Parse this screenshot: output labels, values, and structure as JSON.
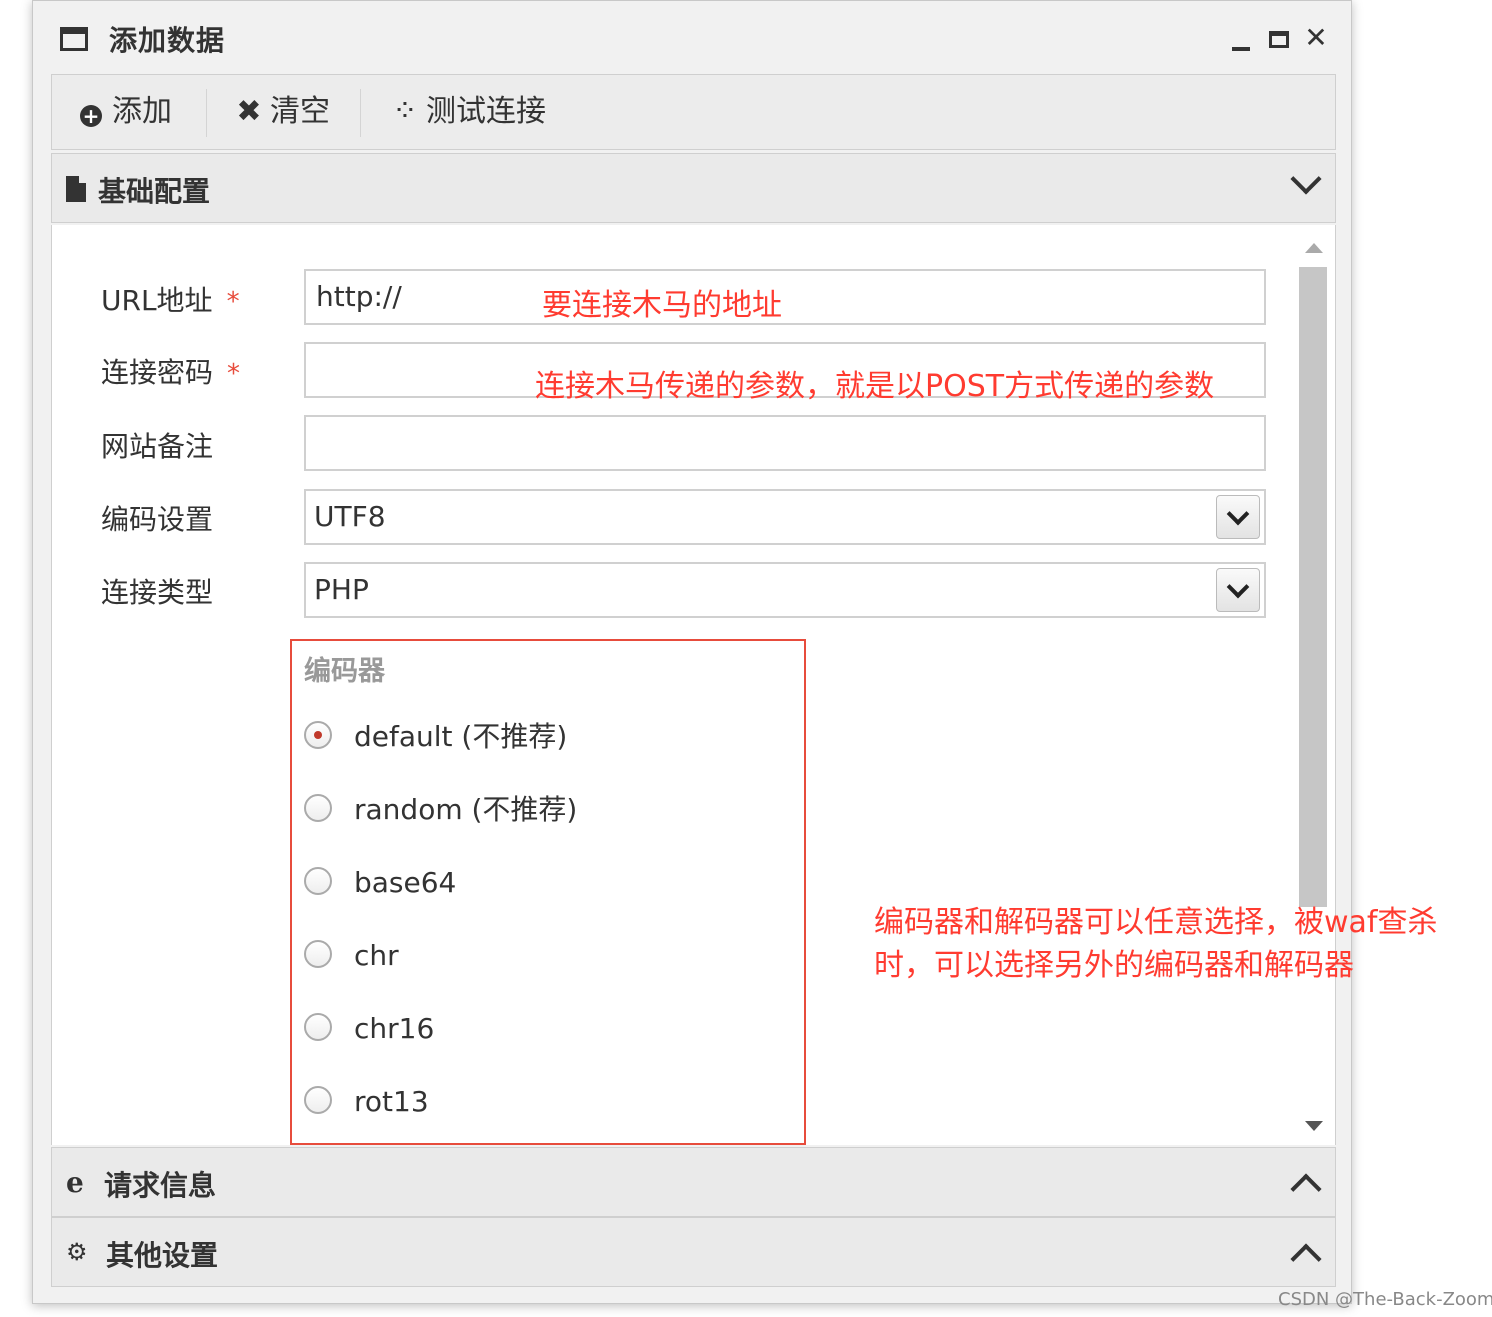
{
  "window": {
    "title": "添加数据"
  },
  "toolbar": {
    "add_label": "添加",
    "clear_label": "清空",
    "test_label": "测试连接"
  },
  "panels": {
    "basic": "基础配置",
    "request": "请求信息",
    "other": "其他设置"
  },
  "form": {
    "url_label": "URL地址",
    "url_value": "http://",
    "password_label": "连接密码",
    "note_label": "网站备注",
    "encoding_label": "编码设置",
    "encoding_value": "UTF8",
    "type_label": "连接类型",
    "type_value": "PHP",
    "required_mark": "*"
  },
  "encoder": {
    "title": "编码器",
    "options": [
      "default (不推荐)",
      "random (不推荐)",
      "base64",
      "chr",
      "chr16",
      "rot13"
    ],
    "selected_index": 0
  },
  "annotations": {
    "url": "要连接木马的地址",
    "password": "连接木马传递的参数，就是以POST方式传递的参数",
    "encoder_line1": "编码器和解码器可以任意选择，被waf查杀",
    "encoder_line2": "时，可以选择另外的编码器和解码器"
  },
  "colors": {
    "annotation": "#ff3b30",
    "required": "#e74c3c",
    "highlight_box": "#e74c3c"
  },
  "watermark": "CSDN @The-Back-Zoom"
}
